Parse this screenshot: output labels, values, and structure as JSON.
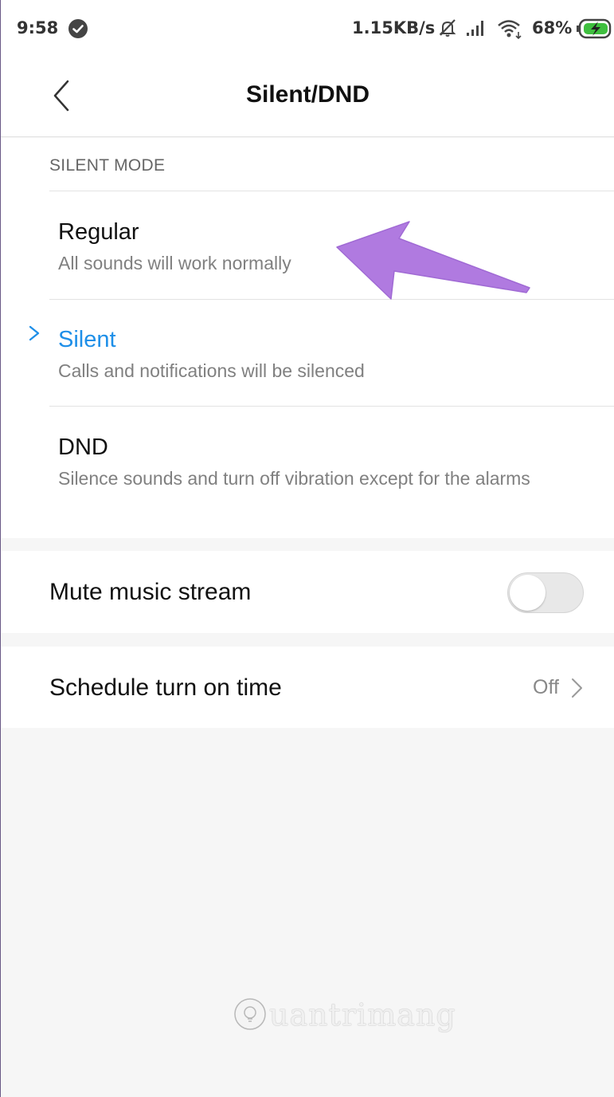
{
  "status_bar": {
    "time": "9:58",
    "net_speed": "1.15KB/s",
    "battery": "68%",
    "icons": [
      "check-circle-icon",
      "mute-bell-icon",
      "signal-icon",
      "wifi-icon",
      "battery-charging-icon"
    ]
  },
  "header": {
    "title": "Silent/DND",
    "back_icon": "chevron-left-icon"
  },
  "silent_mode": {
    "section_label": "SILENT MODE",
    "selected": "Silent",
    "options": [
      {
        "title": "Regular",
        "description": "All sounds will work normally"
      },
      {
        "title": "Silent",
        "description": "Calls and notifications will be silenced"
      },
      {
        "title": "DND",
        "description": "Silence sounds and turn off vibration except for the alarms"
      }
    ]
  },
  "settings": {
    "mute_music_stream": {
      "label": "Mute music stream",
      "enabled": false
    },
    "schedule": {
      "label": "Schedule turn on time",
      "value": "Off"
    }
  },
  "annotation": {
    "arrow_color": "#b07ae0",
    "points_to": "Regular"
  },
  "colors": {
    "accent": "#1e8fe8",
    "toggle_off": "#e8e8e8",
    "background": "#f6f6f6"
  },
  "watermark": {
    "text": "uantrimang"
  }
}
